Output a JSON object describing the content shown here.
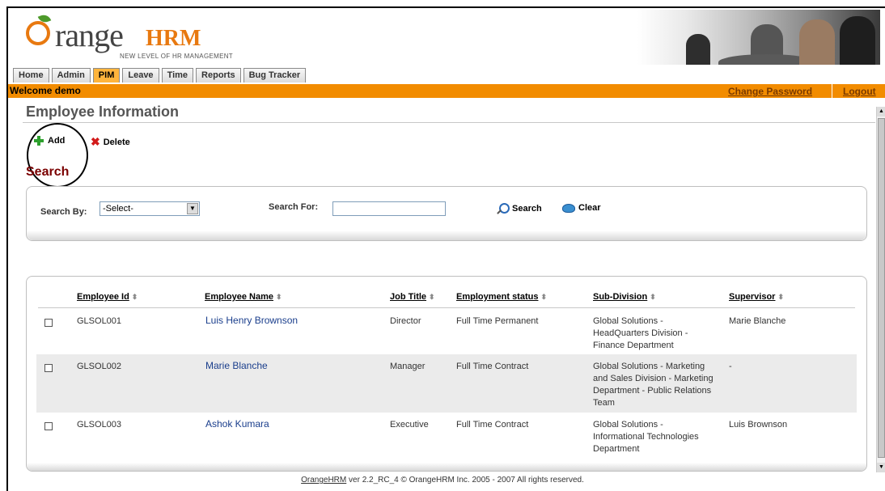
{
  "logo": {
    "brand_orange": "O",
    "brand_range": "range",
    "brand_hrm": "HRM",
    "tagline": "NEW LEVEL OF HR MANAGEMENT"
  },
  "tabs": [
    {
      "label": "Home",
      "active": false
    },
    {
      "label": "Admin",
      "active": false
    },
    {
      "label": "PIM",
      "active": true
    },
    {
      "label": "Leave",
      "active": false
    },
    {
      "label": "Time",
      "active": false
    },
    {
      "label": "Reports",
      "active": false
    },
    {
      "label": "Bug Tracker",
      "active": false
    }
  ],
  "topbar": {
    "welcome": "Welcome demo",
    "change_password": "Change Password",
    "logout": "Logout"
  },
  "page": {
    "title": "Employee Information",
    "add_label": "Add",
    "delete_label": "Delete",
    "search_heading": "Search"
  },
  "search": {
    "search_by_label": "Search By:",
    "search_by_value": "-Select-",
    "search_for_label": "Search For:",
    "search_for_value": "",
    "search_button": "Search",
    "clear_button": "Clear"
  },
  "table": {
    "columns": [
      "Employee Id",
      "Employee Name",
      "Job Title",
      "Employment status",
      "Sub-Division",
      "Supervisor"
    ],
    "rows": [
      {
        "id": "GLSOL001",
        "name": "Luis Henry Brownson",
        "job": "Director",
        "status": "Full Time Permanent",
        "subdivision": [
          "Global Solutions -",
          "HeadQuarters Division -",
          "Finance Department"
        ],
        "supervisor": "Marie Blanche"
      },
      {
        "id": "GLSOL002",
        "name": "Marie Blanche",
        "job": "Manager",
        "status": "Full Time Contract",
        "subdivision": [
          "Global Solutions - Marketing",
          "and Sales Division - Marketing",
          "Department - Public Relations",
          "Team"
        ],
        "supervisor": "-"
      },
      {
        "id": "GLSOL003",
        "name": "Ashok Kumara",
        "job": "Executive",
        "status": "Full Time Contract",
        "subdivision": [
          "Global Solutions -",
          "Informational Technologies",
          "Department"
        ],
        "supervisor": "Luis Brownson"
      }
    ]
  },
  "footer": {
    "link": "OrangeHRM",
    "text": " ver 2.2_RC_4 © OrangeHRM Inc. 2005 - 2007 All rights reserved."
  },
  "colors": {
    "accent": "#f28c00",
    "brand_orange": "#e87910",
    "heading_red": "#7a0000",
    "link_blue": "#1a3e8c"
  }
}
